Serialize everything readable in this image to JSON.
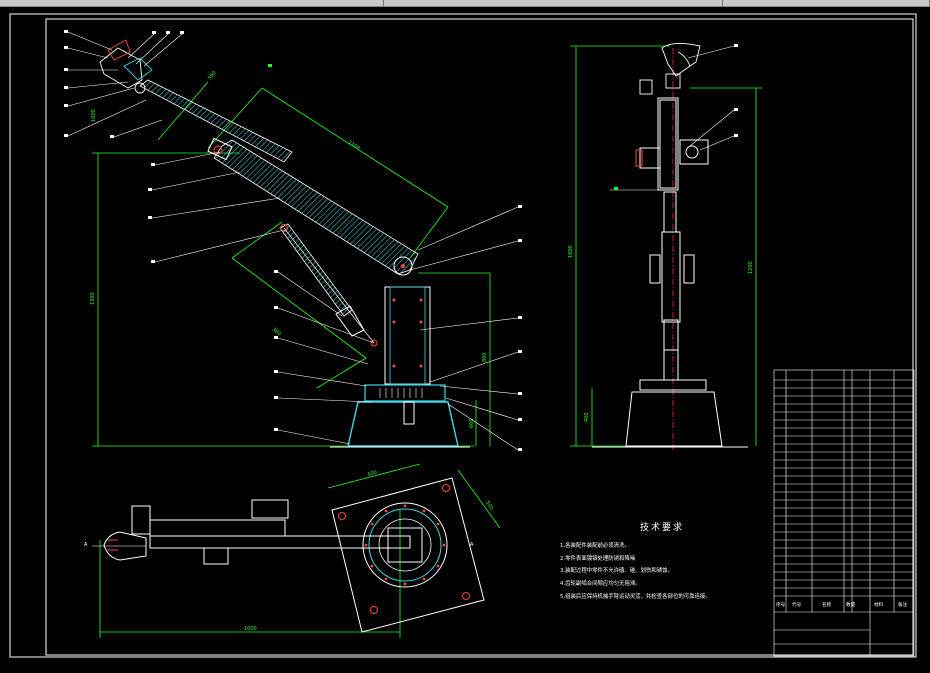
{
  "app": {
    "colors": {
      "background": "#000000",
      "frame": "#ffffff",
      "dimension": "#22ff22",
      "outline": "#ffffff",
      "hatch": "#3fd8e8",
      "centerline": "#ff2a2a",
      "leader": "#ffffff"
    }
  },
  "side_view": {
    "dims": {
      "upper_arm": "1100",
      "wrist": "590",
      "total_height": "1350",
      "forearm": "380",
      "base_height": "800",
      "base_offset": "1000",
      "top_offset": "600"
    }
  },
  "front_view": {
    "dims": {
      "height": "1000",
      "sub_height": "1200",
      "base_h": "400"
    }
  },
  "plan_view": {
    "dims": {
      "length": "1000",
      "square_w": "600",
      "square_h": "500"
    },
    "labels": {
      "left_section": "A",
      "right_section": "A"
    }
  },
  "tech_requirements": {
    "title": "技术要求",
    "notes": [
      "1.各装配件装配前必须清洗。",
      "2.零件表面镀铬处理防锈和降噪",
      "3.装配过程中零件不允许磕、碰、划伤和锈蚀。",
      "4.齿轮副啮合间隙应均匀无阻滞。",
      "5.组装后应保持机械手臂运动灵活，并检查各部位的可靠连接。"
    ]
  },
  "title_block": {
    "captions": [
      "序号",
      "代号",
      "名称",
      "数量",
      "材料",
      "备注"
    ]
  }
}
